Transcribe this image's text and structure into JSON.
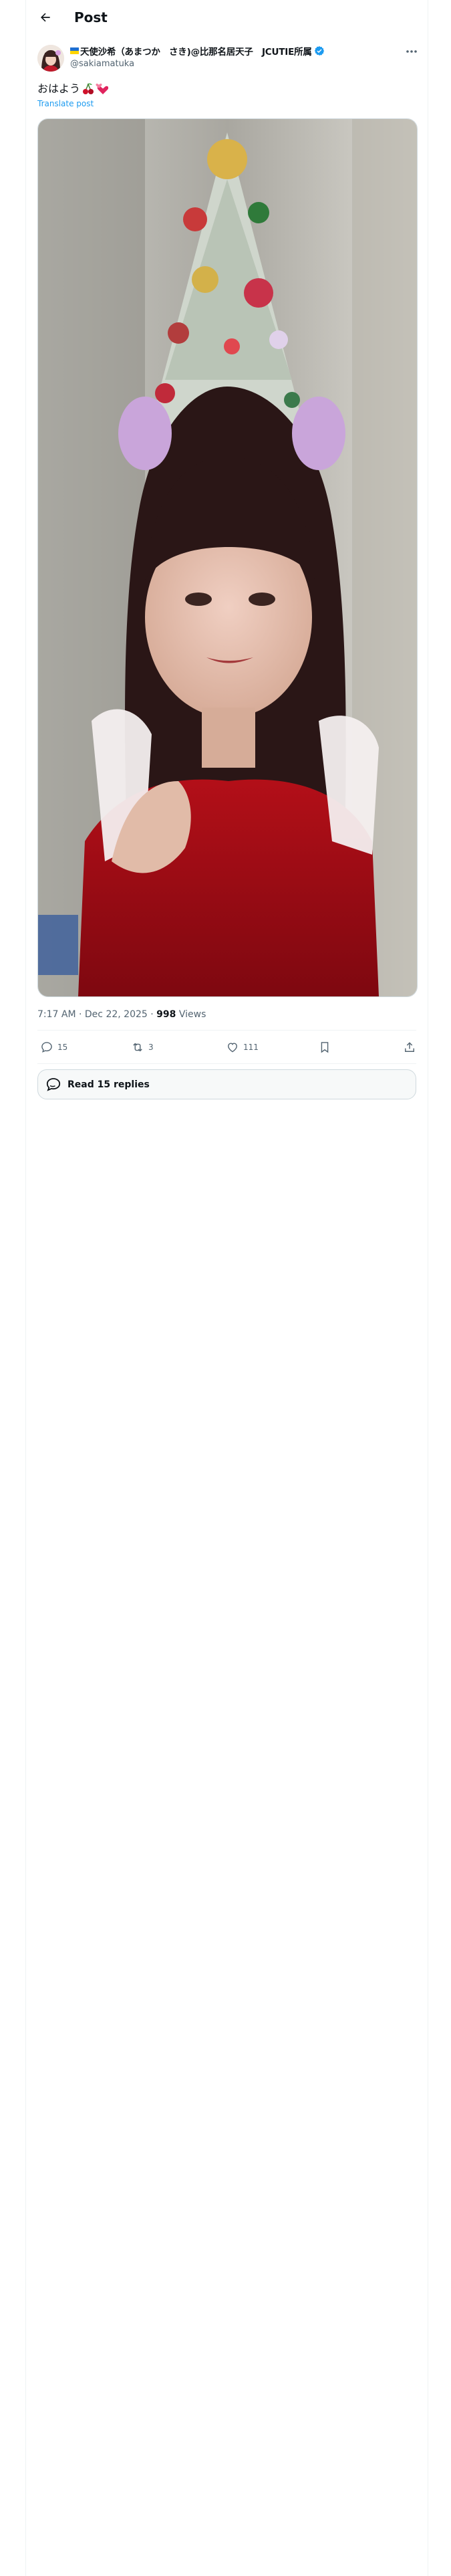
{
  "header": {
    "title": "Post",
    "back_icon": "arrow-left-icon"
  },
  "author": {
    "display_name": "天使沙希（あまつか　さき)@比那名居天子　JCUTIE所属",
    "handle": "@sakiamatuka",
    "flag": "ukraine-flag",
    "verified": true,
    "verified_color": "#1d9bf0"
  },
  "tweet": {
    "text": "おはよう",
    "emoji": [
      "cherries-emoji",
      "two-hearts-emoji"
    ],
    "translate_label": "Translate post",
    "media_description_icon": "photo"
  },
  "meta": {
    "time": "7:17 AM",
    "dot1": "·",
    "date": "Dec 22, 2025",
    "dot2": "·",
    "views_count": "998",
    "views_label": "Views"
  },
  "actions": {
    "replies": "15",
    "reposts": "3",
    "likes": "111"
  },
  "read_replies": {
    "label": "Read 15 replies"
  },
  "colors": {
    "accent": "#1d9bf0",
    "text": "#0f1419",
    "muted": "#536471",
    "border": "#cfd9de"
  }
}
